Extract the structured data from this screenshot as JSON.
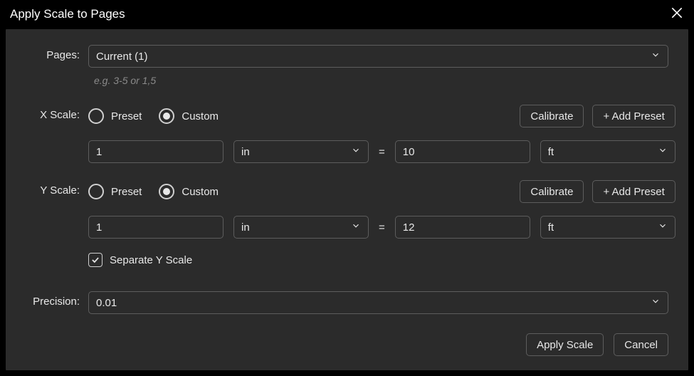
{
  "title": "Apply Scale to Pages",
  "pages": {
    "label": "Pages:",
    "value": "Current (1)",
    "hint": "e.g. 3-5 or 1,5"
  },
  "xscale": {
    "label": "X Scale:",
    "preset_label": "Preset",
    "custom_label": "Custom",
    "mode": "custom",
    "calibrate": "Calibrate",
    "add_preset": "+ Add Preset",
    "from_value": "1",
    "from_unit": "in",
    "to_value": "10",
    "to_unit": "ft",
    "equals": "="
  },
  "yscale": {
    "label": "Y Scale:",
    "preset_label": "Preset",
    "custom_label": "Custom",
    "mode": "custom",
    "calibrate": "Calibrate",
    "add_preset": "+ Add Preset",
    "from_value": "1",
    "from_unit": "in",
    "to_value": "12",
    "to_unit": "ft",
    "equals": "="
  },
  "separate_y": {
    "checked": true,
    "label": "Separate Y Scale"
  },
  "precision": {
    "label": "Precision:",
    "value": "0.01"
  },
  "footer": {
    "apply": "Apply Scale",
    "cancel": "Cancel"
  }
}
